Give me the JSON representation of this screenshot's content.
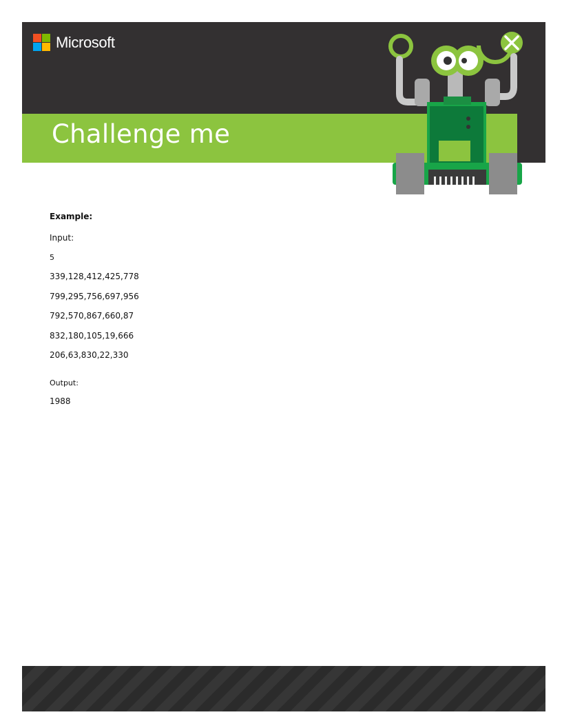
{
  "header": {
    "brand": "Microsoft",
    "title": "Challenge me",
    "logo_colors": [
      "#f25022",
      "#7fba00",
      "#00a4ef",
      "#ffb900"
    ],
    "accent": "#8cc43f",
    "dark": "#333031"
  },
  "content": {
    "example_label": "Example:",
    "input_label": "Input:",
    "count": "5",
    "rows": [
      "339,128,412,425,778",
      "799,295,756,697,956",
      "792,570,867,660,87",
      "832,180,105,19,666",
      "206,63,830,22,330"
    ],
    "output_label": "Output:",
    "output_value": "1988"
  }
}
